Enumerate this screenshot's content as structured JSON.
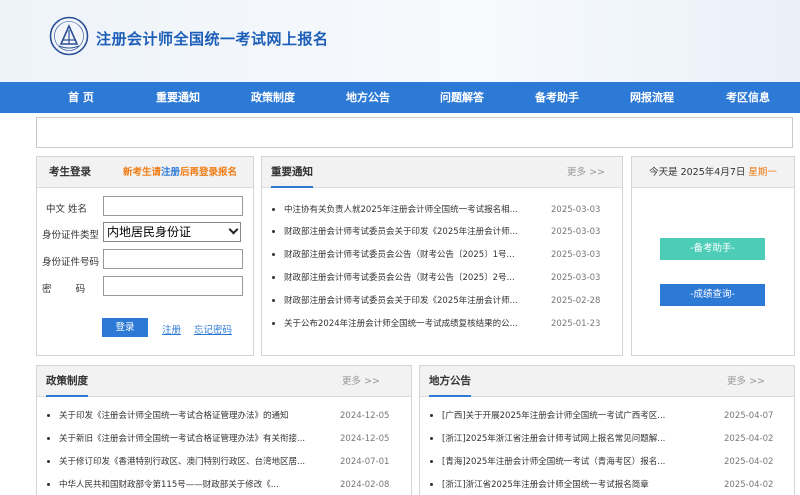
{
  "header": {
    "title": "注册会计师全国统一考试网上报名",
    "logo_icon": "cicpa-emblem-icon"
  },
  "nav": {
    "items": [
      "首 页",
      "重要通知",
      "政策制度",
      "地方公告",
      "问题解答",
      "备考助手",
      "网报流程",
      "考区信息"
    ]
  },
  "login": {
    "title": "考生登录",
    "notice_prefix": "新考生请",
    "notice_link": "注册",
    "notice_suffix": "后再登录报名",
    "name_label": "中文  姓名",
    "id_type_label": "身份证件类型",
    "id_type_value": "内地居民身份证",
    "id_number_label": "身份证件号码",
    "password_label": "密        码",
    "login_button": "登录",
    "register_link": "注册",
    "forgot_link": "忘记密码"
  },
  "notices": {
    "title": "重要通知",
    "more": "更多 >>",
    "items": [
      {
        "text": "中注协有关负责人就2025年注册会计师全国统一考试报名相...",
        "date": "2025-03-03"
      },
      {
        "text": "财政部注册会计师考试委员会关于印发《2025年注册会计师...",
        "date": "2025-03-03"
      },
      {
        "text": "财政部注册会计师考试委员会公告（财考公告〔2025〕1号...",
        "date": "2025-03-03"
      },
      {
        "text": "财政部注册会计师考试委员会公告（财考公告〔2025〕2号...",
        "date": "2025-03-03"
      },
      {
        "text": "财政部注册会计师考试委员会关于印发《2025年注册会计师...",
        "date": "2025-02-28"
      },
      {
        "text": "关于公布2024年注册会计师全国统一考试成绩复核结果的公...",
        "date": "2025-01-23"
      }
    ]
  },
  "today": {
    "prefix": "今天是 2025年4月7日",
    "weekday": "星期一",
    "helper_button": "-备考助手-",
    "score_button": "-成绩查询-"
  },
  "policy": {
    "title": "政策制度",
    "more": "更多 >>",
    "items": [
      {
        "text": "关于印发《注册会计师全国统一考试合格证管理办法》的通知",
        "date": "2024-12-05"
      },
      {
        "text": "关于新旧《注册会计师全国统一考试合格证管理办法》有关衔接...",
        "date": "2024-12-05"
      },
      {
        "text": "关于修订印发《香港特别行政区、澳门特别行政区、台湾地区居...",
        "date": "2024-07-01"
      },
      {
        "text": "中华人民共和国财政部令第115号——财政部关于修改《...",
        "date": "2024-02-08"
      }
    ]
  },
  "local": {
    "title": "地方公告",
    "more": "更多 >>",
    "items": [
      {
        "text": "[广西]关于开展2025年注册会计师全国统一考试广西考区...",
        "date": "2025-04-07"
      },
      {
        "text": "[浙江]2025年浙江省注册会计师考试网上报名常见问题解...",
        "date": "2025-04-02"
      },
      {
        "text": "[青海]2025年注册会计师全国统一考试（青海考区）报名...",
        "date": "2025-04-02"
      },
      {
        "text": "[浙江]浙江省2025年注册会计师全国统一考试报名简章",
        "date": "2025-04-02"
      }
    ]
  },
  "colors": {
    "brand_blue": "#2d7ad6",
    "accent_orange": "#f07d17",
    "helper_teal": "#4dcdb7",
    "score_blue": "#2d7ad6"
  }
}
